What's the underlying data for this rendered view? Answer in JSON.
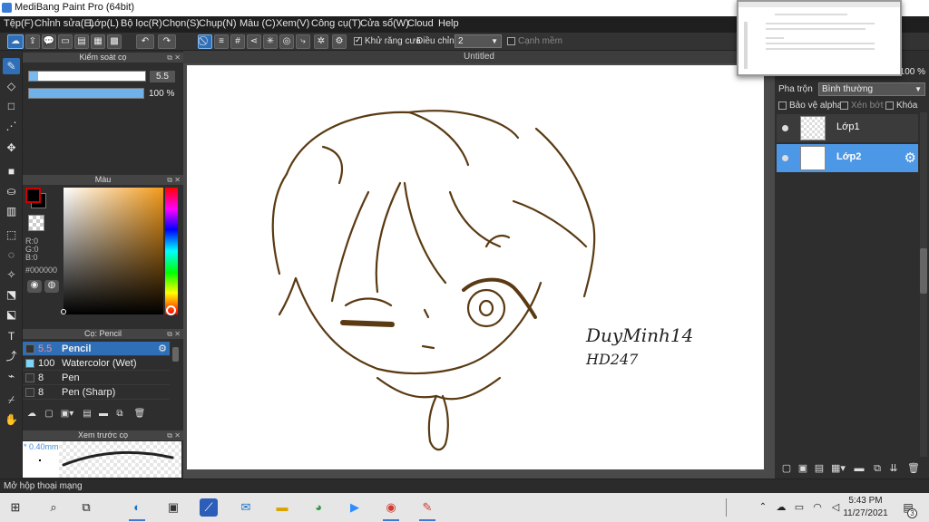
{
  "app": {
    "title": "MediBang Paint Pro (64bit)"
  },
  "menu": [
    "Tệp(F)",
    "Chỉnh sửa(E)",
    "Lớp(L)",
    "Bộ lọc(R)",
    "Chọn(S)",
    "Chụp(N)",
    "Màu (C)",
    "Xem(V)",
    "Công cụ(T)",
    "Cửa sổ(W)",
    "Cloud",
    "Help"
  ],
  "toolbar": {
    "antialias_label": "Khử răng cưa",
    "correction_label": "Điều chỉnh",
    "correction_value": "2",
    "soft_edge_label": "Cạnh mềm"
  },
  "brush_control": {
    "title": "Kiểm soát cọ",
    "size_value": "5.5",
    "opacity_value": "100 %",
    "size_level": 0.08,
    "opacity_level": 1.0
  },
  "color_panel": {
    "title": "Màu",
    "r": "R:0",
    "g": "G:0",
    "b": "B:0",
    "hex": "#000000"
  },
  "brush_list": {
    "title": "Cọ: Pencil",
    "items": [
      {
        "size": "5.5",
        "name": "Pencil",
        "color": "#333333",
        "selected": true
      },
      {
        "size": "100",
        "name": "Watercolor (Wet)",
        "color": "#7fd4f7",
        "selected": false
      },
      {
        "size": "8",
        "name": "Pen",
        "color": "#333333",
        "selected": false
      },
      {
        "size": "8",
        "name": "Pen (Sharp)",
        "color": "#333333",
        "selected": false
      }
    ]
  },
  "preview": {
    "title": "Xem trước cọ",
    "size_label": "* 0.40mm"
  },
  "canvas": {
    "doc_title": "Untitled",
    "signature_line1": "DuyMinh14",
    "signature_line2": "HD247"
  },
  "layers": {
    "zoom": "100 %",
    "blend_label": "Pha trộn",
    "blend_value": "Bình thường",
    "protect_alpha": "Bảo vệ alpha",
    "clipping": "Xén bớt",
    "lock": "Khóa",
    "items": [
      {
        "name": "Lớp1",
        "selected": false
      },
      {
        "name": "Lớp2",
        "selected": true
      }
    ]
  },
  "status": {
    "text": "Mở hộp thoại mạng"
  },
  "taskbar": {
    "time": "5:43 PM",
    "date": "11/27/2021",
    "notification_count": "3"
  },
  "colors": {
    "accent": "#2f6fb7",
    "layer_selected": "#4d98e6",
    "line_art": "#5a3a12"
  }
}
